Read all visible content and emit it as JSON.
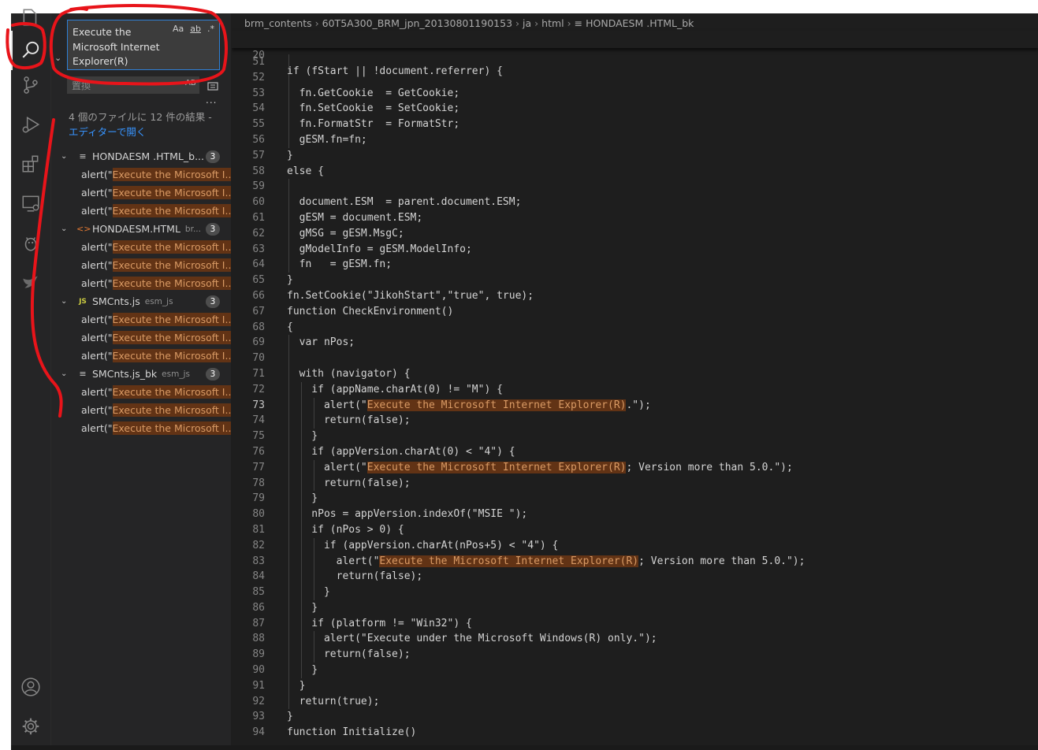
{
  "window": {
    "title": "HONDAESM .HTML_bk"
  },
  "activity_bar": {
    "items": [
      {
        "name": "explorer-icon"
      },
      {
        "name": "search-icon"
      },
      {
        "name": "source-control-icon"
      },
      {
        "name": "run-debug-icon"
      },
      {
        "name": "extensions-icon"
      },
      {
        "name": "remote-explorer-icon"
      },
      {
        "name": "bug-icon"
      },
      {
        "name": "bird-icon"
      }
    ],
    "bottom": [
      {
        "name": "account-icon"
      },
      {
        "name": "settings-gear-icon"
      }
    ]
  },
  "search": {
    "query": "Execute the Microsoft Internet Explorer(R)",
    "options": [
      "Aa",
      "ab",
      ".*"
    ],
    "replace_placeholder": "置換",
    "replace_ab": "AB",
    "more": "...",
    "summary": "4 個のファイルに 12 件の結果 - ",
    "summary_link": "エディターで開く"
  },
  "results": [
    {
      "icon": "≡",
      "icon_color": "#c5c5c5",
      "name": "HONDAESM .HTML_b...",
      "desc": "",
      "count": "3",
      "matches": [
        {
          "pre": "alert(\"",
          "hl": "Execute the Microsoft I..."
        },
        {
          "pre": "alert(\"",
          "hl": "Execute the Microsoft I..."
        },
        {
          "pre": "alert(\"",
          "hl": "Execute the Microsoft I..."
        }
      ]
    },
    {
      "icon": "<>",
      "icon_color": "#e37933",
      "name": "HONDAESM.HTML",
      "desc": "br...",
      "count": "3",
      "matches": [
        {
          "pre": "alert(\"",
          "hl": "Execute the Microsoft I..."
        },
        {
          "pre": "alert(\"",
          "hl": "Execute the Microsoft I..."
        },
        {
          "pre": "alert(\"",
          "hl": "Execute the Microsoft I..."
        }
      ]
    },
    {
      "icon": "JS",
      "icon_color": "#cbcb41",
      "name": "SMCnts.js",
      "desc": "esm_js",
      "count": "3",
      "matches": [
        {
          "pre": "alert(\"",
          "hl": "Execute the Microsoft I..."
        },
        {
          "pre": "alert(\"",
          "hl": "Execute the Microsoft I..."
        },
        {
          "pre": "alert(\"",
          "hl": "Execute the Microsoft I..."
        }
      ]
    },
    {
      "icon": "≡",
      "icon_color": "#c5c5c5",
      "name": "SMCnts.js_bk",
      "desc": "esm_js",
      "count": "3",
      "matches": [
        {
          "pre": "alert(\"",
          "hl": "Execute the Microsoft I..."
        },
        {
          "pre": "alert(\"",
          "hl": "Execute the Microsoft I..."
        },
        {
          "pre": "alert(\"",
          "hl": "Execute the Microsoft I..."
        }
      ]
    }
  ],
  "breadcrumb": [
    "brm_contents",
    "60T5A300_BRM_jpn_20130801190153",
    "ja",
    "html",
    "≡ HONDAESM .HTML_bk"
  ],
  "sticky_line": {
    "num": "20",
    "text": "if (fStart || !document.referrer) {"
  },
  "active_line": "73",
  "code_lines": [
    {
      "num": "51",
      "indent": 1,
      "pre": "",
      "hl": "",
      "post": ""
    },
    {
      "num": "52",
      "indent": 1,
      "pre": "",
      "hl": "",
      "post": ""
    },
    {
      "num": "53",
      "indent": 1,
      "pre": "  fn.GetCookie  = GetCookie;",
      "hl": "",
      "post": ""
    },
    {
      "num": "54",
      "indent": 1,
      "pre": "  fn.SetCookie  = SetCookie;",
      "hl": "",
      "post": ""
    },
    {
      "num": "55",
      "indent": 1,
      "pre": "  fn.FormatStr  = FormatStr;",
      "hl": "",
      "post": ""
    },
    {
      "num": "56",
      "indent": 1,
      "pre": "  gESM.fn=fn;",
      "hl": "",
      "post": ""
    },
    {
      "num": "57",
      "indent": 0,
      "pre": "}",
      "hl": "",
      "post": ""
    },
    {
      "num": "58",
      "indent": 0,
      "pre": "else {",
      "hl": "",
      "post": ""
    },
    {
      "num": "59",
      "indent": 1,
      "pre": "",
      "hl": "",
      "post": ""
    },
    {
      "num": "60",
      "indent": 1,
      "pre": "  document.ESM  = parent.document.ESM;",
      "hl": "",
      "post": ""
    },
    {
      "num": "61",
      "indent": 1,
      "pre": "  gESM = document.ESM;",
      "hl": "",
      "post": ""
    },
    {
      "num": "62",
      "indent": 1,
      "pre": "  gMSG = gESM.MsgC;",
      "hl": "",
      "post": ""
    },
    {
      "num": "63",
      "indent": 1,
      "pre": "  gModelInfo = gESM.ModelInfo;",
      "hl": "",
      "post": ""
    },
    {
      "num": "64",
      "indent": 1,
      "pre": "  fn   = gESM.fn;",
      "hl": "",
      "post": ""
    },
    {
      "num": "65",
      "indent": 0,
      "pre": "}",
      "hl": "",
      "post": ""
    },
    {
      "num": "66",
      "indent": 0,
      "pre": "fn.SetCookie(\"JikohStart\",\"true\", true);",
      "hl": "",
      "post": ""
    },
    {
      "num": "67",
      "indent": 0,
      "pre": "function CheckEnvironment()",
      "hl": "",
      "post": ""
    },
    {
      "num": "68",
      "indent": 0,
      "pre": "{",
      "hl": "",
      "post": ""
    },
    {
      "num": "69",
      "indent": 1,
      "pre": "  var nPos;",
      "hl": "",
      "post": ""
    },
    {
      "num": "70",
      "indent": 1,
      "pre": "",
      "hl": "",
      "post": ""
    },
    {
      "num": "71",
      "indent": 1,
      "pre": "  with (navigator) {",
      "hl": "",
      "post": ""
    },
    {
      "num": "72",
      "indent": 2,
      "pre": "    if (appName.charAt(0) != \"M\") {",
      "hl": "",
      "post": ""
    },
    {
      "num": "73",
      "indent": 3,
      "pre": "      alert(\"",
      "hl": "Execute the Microsoft Internet Explorer(R)",
      "post": ".\");"
    },
    {
      "num": "74",
      "indent": 3,
      "pre": "      return(false);",
      "hl": "",
      "post": ""
    },
    {
      "num": "75",
      "indent": 2,
      "pre": "    }",
      "hl": "",
      "post": ""
    },
    {
      "num": "76",
      "indent": 2,
      "pre": "    if (appVersion.charAt(0) < \"4\") {",
      "hl": "",
      "post": ""
    },
    {
      "num": "77",
      "indent": 3,
      "pre": "      alert(\"",
      "hl": "Execute the Microsoft Internet Explorer(R)",
      "post": "; Version more than 5.0.\");"
    },
    {
      "num": "78",
      "indent": 3,
      "pre": "      return(false);",
      "hl": "",
      "post": ""
    },
    {
      "num": "79",
      "indent": 2,
      "pre": "    }",
      "hl": "",
      "post": ""
    },
    {
      "num": "80",
      "indent": 2,
      "pre": "    nPos = appVersion.indexOf(\"MSIE \");",
      "hl": "",
      "post": ""
    },
    {
      "num": "81",
      "indent": 2,
      "pre": "    if (nPos > 0) {",
      "hl": "",
      "post": ""
    },
    {
      "num": "82",
      "indent": 3,
      "pre": "      if (appVersion.charAt(nPos+5) < \"4\") {",
      "hl": "",
      "post": ""
    },
    {
      "num": "83",
      "indent": 4,
      "pre": "        alert(\"",
      "hl": "Execute the Microsoft Internet Explorer(R)",
      "post": "; Version more than 5.0.\");"
    },
    {
      "num": "84",
      "indent": 4,
      "pre": "        return(false);",
      "hl": "",
      "post": ""
    },
    {
      "num": "85",
      "indent": 3,
      "pre": "      }",
      "hl": "",
      "post": ""
    },
    {
      "num": "86",
      "indent": 2,
      "pre": "    }",
      "hl": "",
      "post": ""
    },
    {
      "num": "87",
      "indent": 2,
      "pre": "    if (platform != \"Win32\") {",
      "hl": "",
      "post": ""
    },
    {
      "num": "88",
      "indent": 3,
      "pre": "      alert(\"Execute under the Microsoft Windows(R) only.\");",
      "hl": "",
      "post": ""
    },
    {
      "num": "89",
      "indent": 3,
      "pre": "      return(false);",
      "hl": "",
      "post": ""
    },
    {
      "num": "90",
      "indent": 2,
      "pre": "    }",
      "hl": "",
      "post": ""
    },
    {
      "num": "91",
      "indent": 1,
      "pre": "  }",
      "hl": "",
      "post": ""
    },
    {
      "num": "92",
      "indent": 1,
      "pre": "  return(true);",
      "hl": "",
      "post": ""
    },
    {
      "num": "93",
      "indent": 0,
      "pre": "}",
      "hl": "",
      "post": ""
    },
    {
      "num": "94",
      "indent": 0,
      "pre": "function Initialize()",
      "hl": "",
      "post": ""
    }
  ],
  "colors": {
    "match_bg": "#623315",
    "match_fg": "#d99a64",
    "annotation": "#e8141a",
    "link": "#3794ff"
  }
}
